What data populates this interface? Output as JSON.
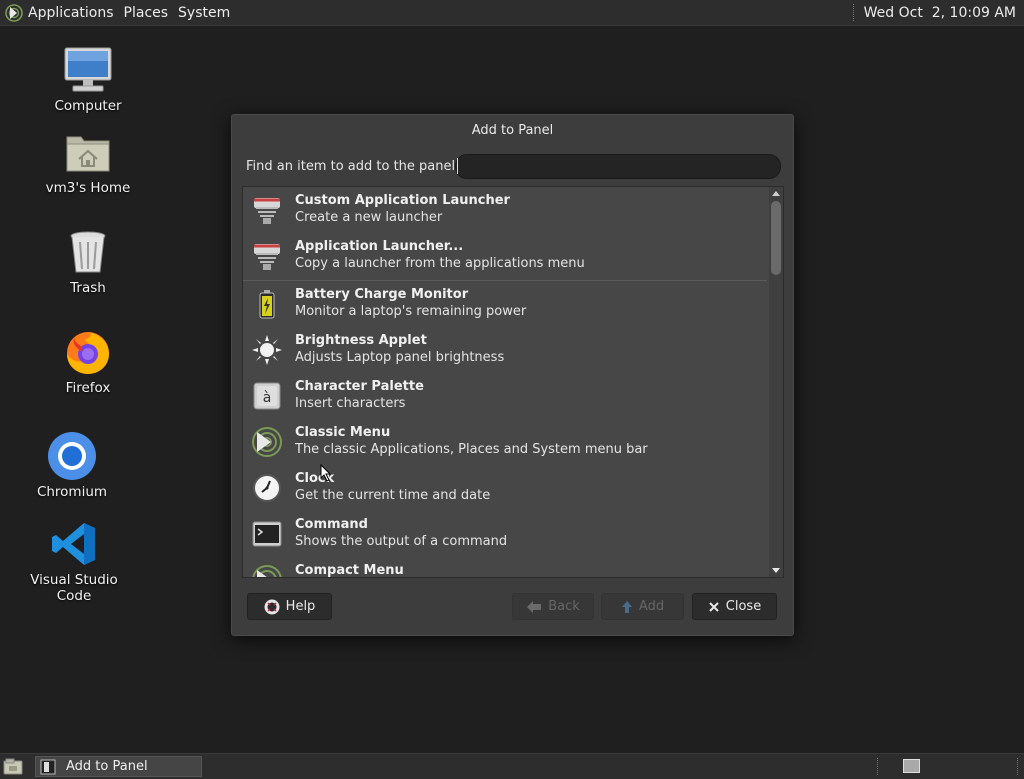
{
  "top_panel": {
    "menus": [
      "Applications",
      "Places",
      "System"
    ],
    "clock": "Wed Oct  2, 10:09 AM"
  },
  "desktop": {
    "icons": [
      {
        "label": "Computer",
        "icon": "computer-icon"
      },
      {
        "label": "vm3's Home",
        "icon": "home-folder-icon"
      },
      {
        "label": "Trash",
        "icon": "trash-icon"
      },
      {
        "label": "Firefox",
        "icon": "firefox-icon"
      },
      {
        "label": "Chromium",
        "icon": "chromium-icon"
      },
      {
        "label": "Visual Studio Code",
        "icon": "vscode-icon"
      }
    ]
  },
  "dialog": {
    "title": "Add to Panel",
    "find_label": "Find an item to add to the panel:",
    "search_value": "",
    "items": [
      {
        "title": "Custom Application Launcher",
        "desc": "Create a new launcher",
        "icon": "launcher-icon"
      },
      {
        "title": "Application Launcher...",
        "desc": "Copy a launcher from the applications menu",
        "icon": "launcher-icon"
      },
      {
        "title": "Battery Charge Monitor",
        "desc": "Monitor a laptop's remaining power",
        "icon": "battery-icon"
      },
      {
        "title": "Brightness Applet",
        "desc": "Adjusts Laptop panel brightness",
        "icon": "brightness-icon"
      },
      {
        "title": "Character Palette",
        "desc": "Insert characters",
        "icon": "character-palette-icon"
      },
      {
        "title": "Classic Menu",
        "desc": "The classic Applications, Places and System menu bar",
        "icon": "mate-menu-icon"
      },
      {
        "title": "Clock",
        "desc": "Get the current time and date",
        "icon": "clock-icon"
      },
      {
        "title": "Command",
        "desc": "Shows the output of a command",
        "icon": "terminal-icon"
      },
      {
        "title": "Compact Menu",
        "desc": "",
        "icon": "mate-menu-icon"
      }
    ],
    "buttons": {
      "help": "Help",
      "back": "Back",
      "add": "Add",
      "close": "Close"
    }
  },
  "bottom_panel": {
    "task": "Add to Panel"
  },
  "colors": {
    "desktop_bg": "#1f1f1f",
    "panel_bg": "#2d2d2d",
    "dialog_bg": "#3d3d3d",
    "list_bg": "#474747"
  }
}
